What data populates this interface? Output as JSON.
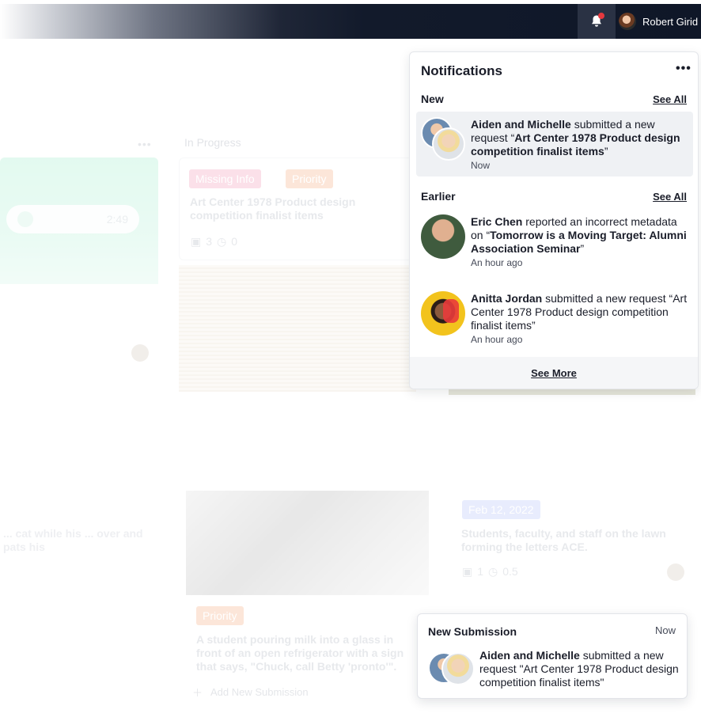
{
  "topbar": {
    "user_name": "Robert Girid",
    "notification_dot_color": "#e5393e"
  },
  "board": {
    "column_label": "In Progress",
    "column_menu": "•••",
    "audio_time": "2:49",
    "card1": {
      "tags": [
        "Missing Info",
        "Priority"
      ],
      "title": "Art Center 1978 Product design competition finalist items",
      "images": "3",
      "hours": "0"
    },
    "card2": {
      "tag": "Priority",
      "title": "A student pouring milk into a glass in front of an open refrigerator with a sign that says, \"Chuck, call Betty 'pronto'\"."
    },
    "card3": {
      "tag": "Feb 12, 2022",
      "title": "Students, faculty, and staff on the lawn forming the letters ACE.",
      "images": "1",
      "hours": "0.5"
    },
    "left_card_text": "... cat while his ... over and pats his",
    "add_submission": "Add New Submission"
  },
  "notifications": {
    "title": "Notifications",
    "menu": "•••",
    "new_label": "New",
    "earlier_label": "Earlier",
    "see_all": "See All",
    "see_more": "See More",
    "new_items": [
      {
        "actor": "Aiden and Michelle",
        "action": " submitted a new request “",
        "subject": "Art Center 1978 Product design competition finalist items",
        "tail": "”",
        "time": "Now"
      }
    ],
    "earlier_items": [
      {
        "actor": "Eric Chen",
        "action": " reported an incorrect metadata on “",
        "subject": "Tomorrow is a Moving Target: Alumni Association Seminar",
        "tail": "”",
        "time": "An hour ago"
      },
      {
        "actor": "Anitta Jordan",
        "action": " submitted a new request “Art Center 1978 Product design competition finalist items”",
        "time": "An hour ago"
      }
    ]
  },
  "toast": {
    "title": "New Submission",
    "time": "Now",
    "actor": "Aiden and Michelle",
    "action": " submitted a new request \"Art Center 1978 Product design competition finalist items\""
  }
}
